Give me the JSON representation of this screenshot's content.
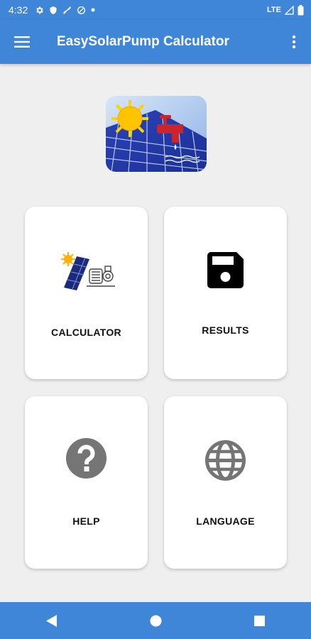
{
  "status_bar": {
    "time": "4:32",
    "network": "LTE",
    "icons": [
      "gear-icon",
      "shield-icon",
      "no-link-icon",
      "data-saver-icon",
      "dot-icon",
      "signal-icon",
      "battery-icon"
    ]
  },
  "app_bar": {
    "title": "EasySolarPump Calculator",
    "menu_icon": "hamburger-menu-icon",
    "overflow_icon": "more-vert-icon"
  },
  "logo": {
    "icon": "solar-pump-logo"
  },
  "menu": {
    "calculator": {
      "label": "CALCULATOR",
      "icon": "solar-panel-pump-icon"
    },
    "results": {
      "label": "RESULTS",
      "icon": "floppy-disk-icon"
    },
    "help": {
      "label": "HELP",
      "icon": "question-circle-icon"
    },
    "language": {
      "label": "LANGUAGE",
      "icon": "globe-icon"
    }
  },
  "colors": {
    "primary": "#3f86d8",
    "background": "#efefef",
    "card": "#ffffff",
    "icon_gray": "#757575"
  },
  "nav_bar": {
    "back_icon": "back-triangle-icon",
    "home_icon": "home-circle-icon",
    "recents_icon": "recents-square-icon"
  }
}
